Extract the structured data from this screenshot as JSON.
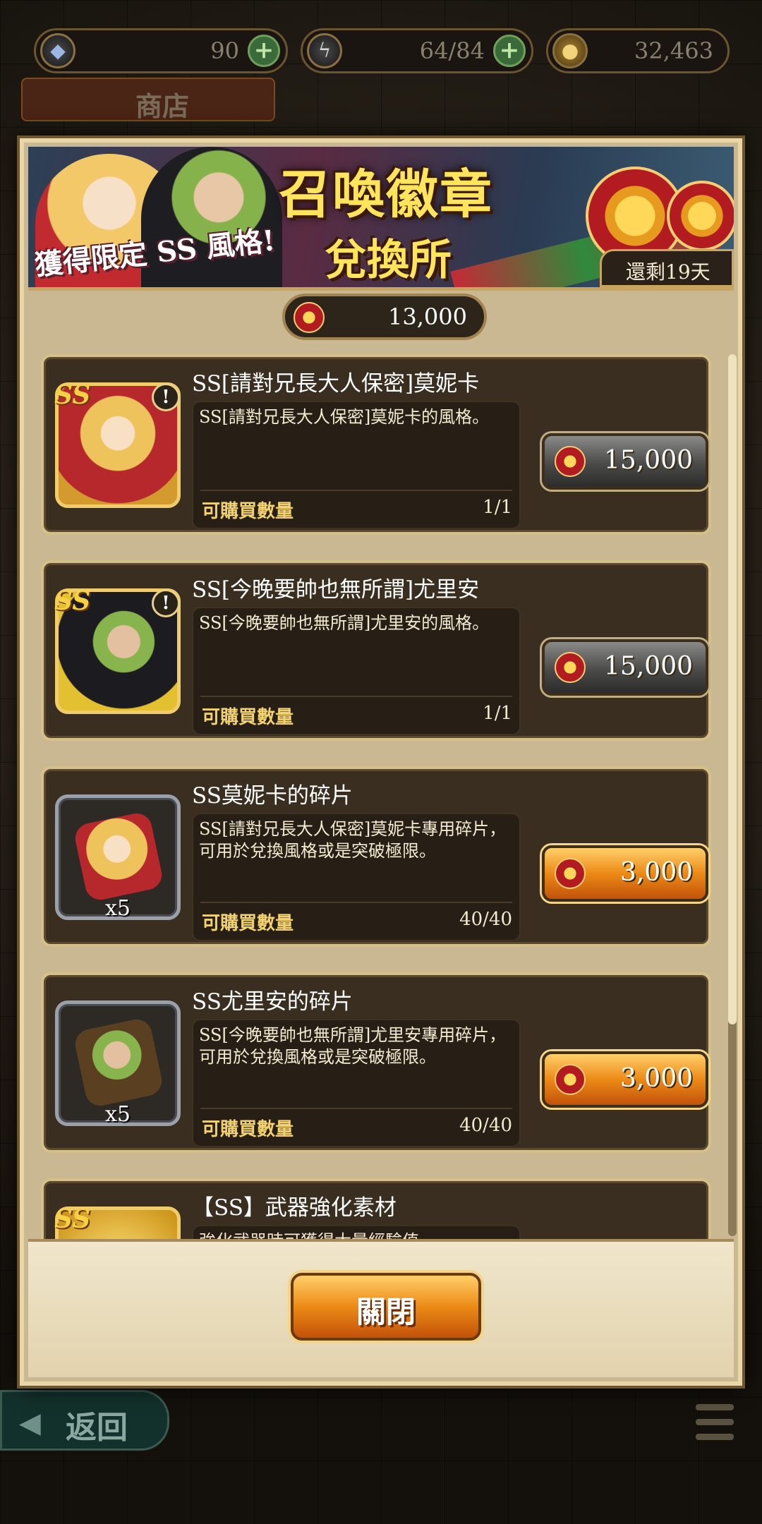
{
  "resources": {
    "gems": "90",
    "stamina": "64/84",
    "gold": "32,463"
  },
  "shop_tab": "商店",
  "back_button": "返回",
  "banner": {
    "tagline": "獲得限定 SS 風格!",
    "title": "召喚徽章",
    "subtitle": "兌換所",
    "days_left": "還剩19天"
  },
  "currency": {
    "badges": "13,000"
  },
  "items": [
    {
      "name": "SS[請對兄長大人保密]莫妮卡",
      "desc": "SS[請對兄長大人保密]莫妮卡的風格。",
      "buy_label": "可購買數量",
      "buy_count": "1/1",
      "price": "15,000",
      "badge": "SS",
      "qty": ""
    },
    {
      "name": "SS[今晚要帥也無所謂]尤里安",
      "desc": "SS[今晚要帥也無所謂]尤里安的風格。",
      "buy_label": "可購買數量",
      "buy_count": "1/1",
      "price": "15,000",
      "badge": "SS",
      "qty": ""
    },
    {
      "name": "SS莫妮卡的碎片",
      "desc": "SS[請對兄長大人保密]莫妮卡專用碎片，可用於兌換風格或是突破極限。",
      "buy_label": "可購買數量",
      "buy_count": "40/40",
      "price": "3,000",
      "badge": "",
      "qty": "x5"
    },
    {
      "name": "SS尤里安的碎片",
      "desc": "SS[今晚要帥也無所謂]尤里安專用碎片，可用於兌換風格或是突破極限。",
      "buy_label": "可購買數量",
      "buy_count": "40/40",
      "price": "3,000",
      "badge": "",
      "qty": "x5"
    },
    {
      "name": "【SS】武器強化素材",
      "desc": "強化武器時可獲得大量經驗值。",
      "badge": "SS"
    }
  ],
  "close_button": "關閉",
  "icons": [
    "gem-icon",
    "stamina-icon",
    "gold-coin-icon",
    "plus-icon",
    "summon-medal-icon",
    "exclamation-icon",
    "back-arrow-icon",
    "menu-icon"
  ]
}
